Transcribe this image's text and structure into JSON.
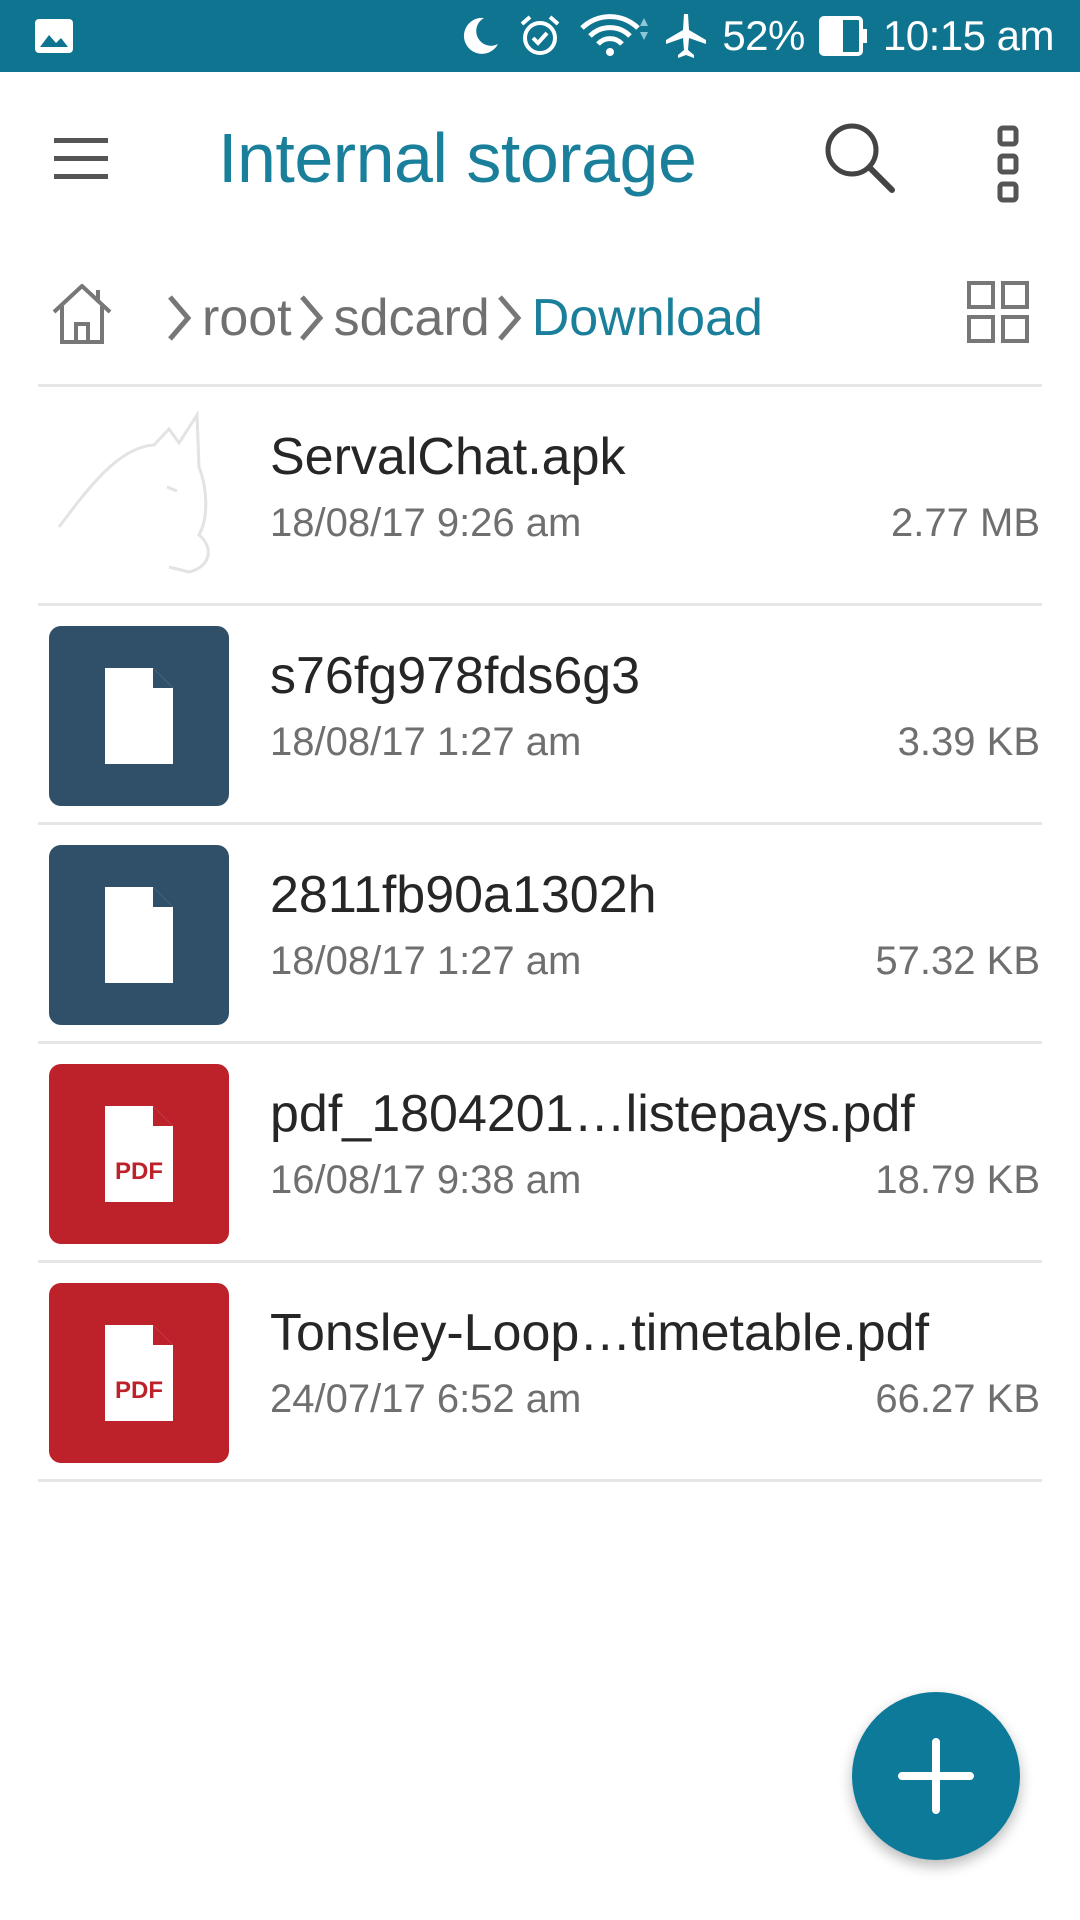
{
  "status_bar": {
    "battery": "52%",
    "time": "10:15 am",
    "icons": [
      "image-icon",
      "moon-icon",
      "alarm-icon",
      "wifi-icon",
      "airplane-icon",
      "battery-icon"
    ]
  },
  "app_bar": {
    "title": "Internal storage",
    "icons": [
      "menu-icon",
      "search-icon",
      "more-vert-icon"
    ]
  },
  "breadcrumb": {
    "items": [
      "root",
      "sdcard",
      "Download"
    ],
    "active": "Download",
    "icons": [
      "home-icon",
      "chevron-right-icon",
      "grid-view-icon"
    ]
  },
  "files": [
    {
      "name": "ServalChat.apk",
      "date": "18/08/17 9:26 am",
      "size": "2.77 MB",
      "type": "apk",
      "icon": "cat-app-icon"
    },
    {
      "name": "s76fg978fds6g3",
      "date": "18/08/17 1:27 am",
      "size": "3.39 KB",
      "type": "doc",
      "icon": "file-icon"
    },
    {
      "name": "2811fb90a1302h",
      "date": "18/08/17 1:27 am",
      "size": "57.32 KB",
      "type": "doc",
      "icon": "file-icon"
    },
    {
      "name": "pdf_1804201…listepays.pdf",
      "date": "16/08/17 9:38 am",
      "size": "18.79 KB",
      "type": "pdf",
      "icon": "pdf-file-icon",
      "badge": "PDF"
    },
    {
      "name": "Tonsley-Loop…timetable.pdf",
      "date": "24/07/17 6:52 am",
      "size": "66.27 KB",
      "type": "pdf",
      "icon": "pdf-file-icon",
      "badge": "PDF"
    }
  ],
  "fab": {
    "icon": "plus-icon"
  },
  "colors": {
    "status_bar": "#0e7490",
    "accent": "#1a7f9b",
    "doc_tile": "#2f5068",
    "pdf_tile": "#bd222b",
    "fab": "#0e7a99"
  }
}
